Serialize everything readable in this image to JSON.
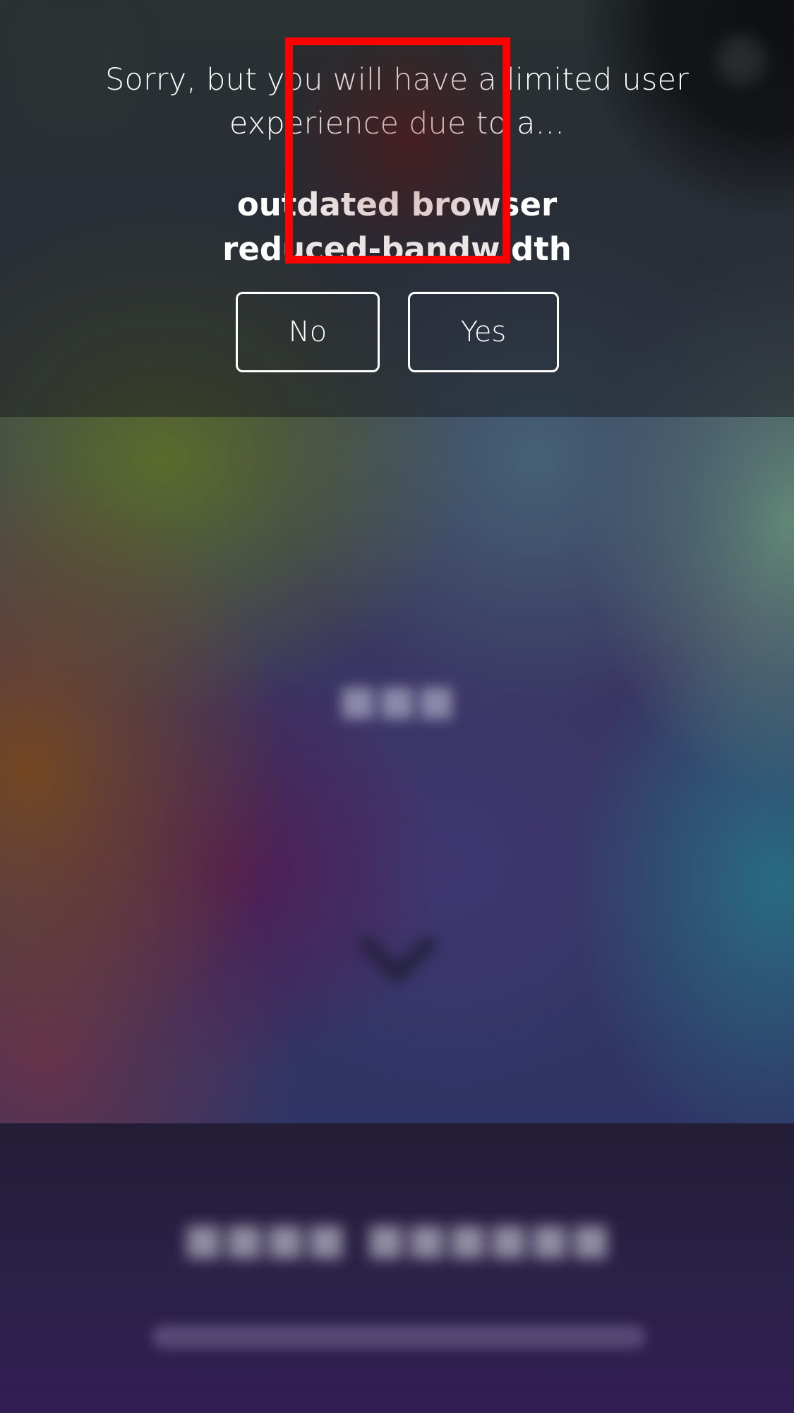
{
  "notice": {
    "message": "Sorry, but you will have a limited user experience due to a...",
    "reasons": [
      "outdated browser",
      "reduced-bandwidth"
    ],
    "no_label": "No",
    "yes_label": "Yes"
  },
  "background": {
    "hero_icon": "chevron-down-icon"
  },
  "colors": {
    "overlay": "#1c1e22",
    "button_border": "#ffffff",
    "highlight": "#ff0000"
  }
}
